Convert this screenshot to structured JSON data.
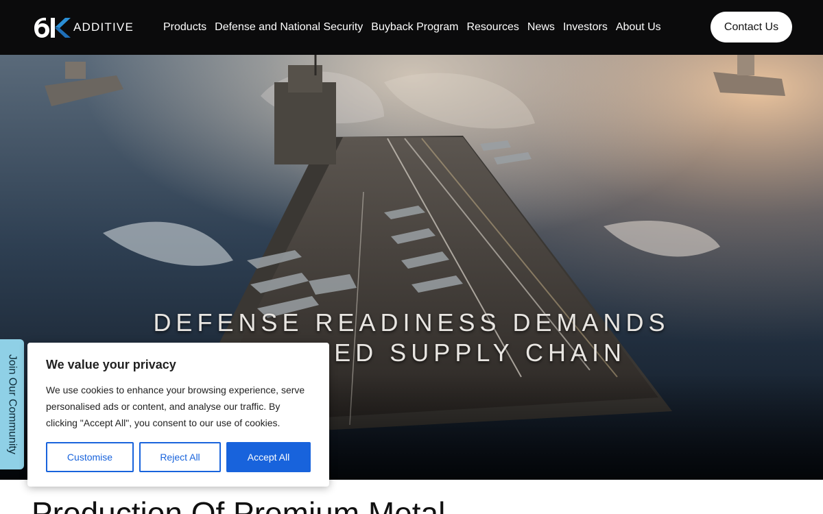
{
  "brand": {
    "logo_number": "6K",
    "logo_word": "ADDITIVE"
  },
  "nav": {
    "items": [
      {
        "label": "Products"
      },
      {
        "label": "Defense and National Security"
      },
      {
        "label": "Buyback Program"
      },
      {
        "label": "Resources"
      },
      {
        "label": "News"
      },
      {
        "label": "Investors"
      },
      {
        "label": "About Us"
      }
    ],
    "contact_label": "Contact Us"
  },
  "hero": {
    "line1": "DEFENSE READINESS DEMANDS",
    "line2": "A TRUSTED SUPPLY CHAIN"
  },
  "section": {
    "heading": "Production Of Premium Metal"
  },
  "community_tab": {
    "label": "Join Our Community"
  },
  "cookie": {
    "title": "We value your privacy",
    "body": "We use cookies to enhance your browsing experience, serve personalised ads or content, and analyse our traffic. By clicking \"Accept All\", you consent to our use of cookies.",
    "customise_label": "Customise",
    "reject_label": "Reject All",
    "accept_label": "Accept All"
  },
  "colors": {
    "header_bg": "#0b0b0c",
    "logo_accent": "#2b8fd6",
    "cookie_accent": "#1863dc",
    "community_tab": "#8fd0e6"
  }
}
